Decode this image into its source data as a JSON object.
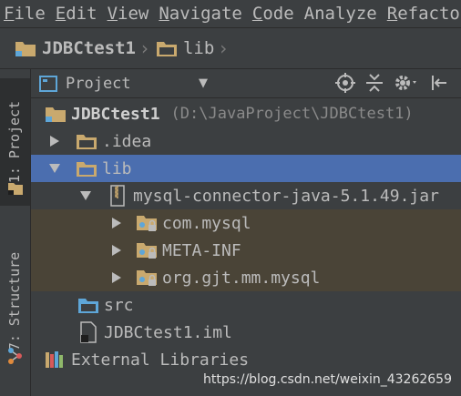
{
  "menu": [
    {
      "mnemonic": "F",
      "rest": "ile"
    },
    {
      "mnemonic": "E",
      "rest": "dit"
    },
    {
      "mnemonic": "V",
      "rest": "iew"
    },
    {
      "mnemonic": "N",
      "rest": "avigate"
    },
    {
      "mnemonic": "C",
      "rest": "ode"
    },
    {
      "mnemonic": "",
      "rest": "Analyze"
    },
    {
      "mnemonic": "R",
      "rest": "efactor"
    }
  ],
  "breadcrumb": [
    {
      "label": "JDBCtest1"
    },
    {
      "label": "lib"
    }
  ],
  "left_tabs": {
    "project": "1: Project",
    "structure": "7: Structure"
  },
  "panel": {
    "view_label": "Project"
  },
  "tree": {
    "root": {
      "label": "JDBCtest1",
      "path": "(D:\\JavaProject\\JDBCtest1)"
    },
    "idea": ".idea",
    "lib": "lib",
    "jar": "mysql-connector-java-5.1.49.jar",
    "pkg_com": "com.mysql",
    "pkg_meta": "META-INF",
    "pkg_org": "org.gjt.mm.mysql",
    "src": "src",
    "iml": "JDBCtest1.iml",
    "external": "External Libraries"
  },
  "watermark": "https://blog.csdn.net/weixin_43262659",
  "colors": {
    "background": "#3c3f41",
    "selection": "#4b6eaf",
    "folder": "#c9a96e",
    "source_folder": "#5ea6d8"
  }
}
